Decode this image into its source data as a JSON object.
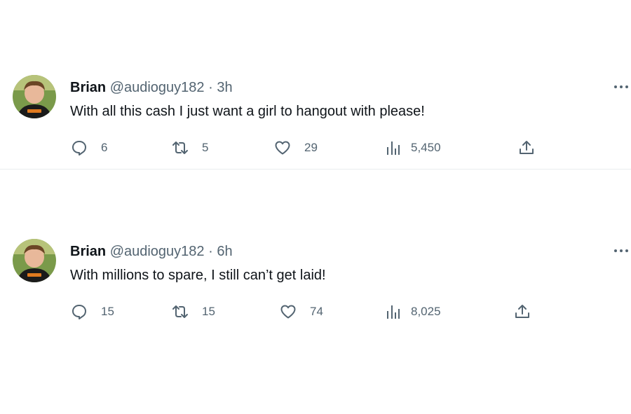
{
  "tweets": [
    {
      "name": "Brian",
      "handle": "@audioguy182",
      "separator": "·",
      "time": "3h",
      "text": "With all this cash I just want a girl to hangout with please!",
      "replies": "6",
      "retweets": "5",
      "likes": "29",
      "views": "5,450"
    },
    {
      "name": "Brian",
      "handle": "@audioguy182",
      "separator": "·",
      "time": "6h",
      "text": "With millions to spare, I still can’t get laid!",
      "replies": "15",
      "retweets": "15",
      "likes": "74",
      "views": "8,025"
    }
  ],
  "colors": {
    "text": "#0f1419",
    "secondary": "#536471",
    "divider": "#e9ecee"
  },
  "icons": [
    "reply-icon",
    "retweet-icon",
    "like-icon",
    "views-icon",
    "share-icon",
    "more-icon"
  ]
}
